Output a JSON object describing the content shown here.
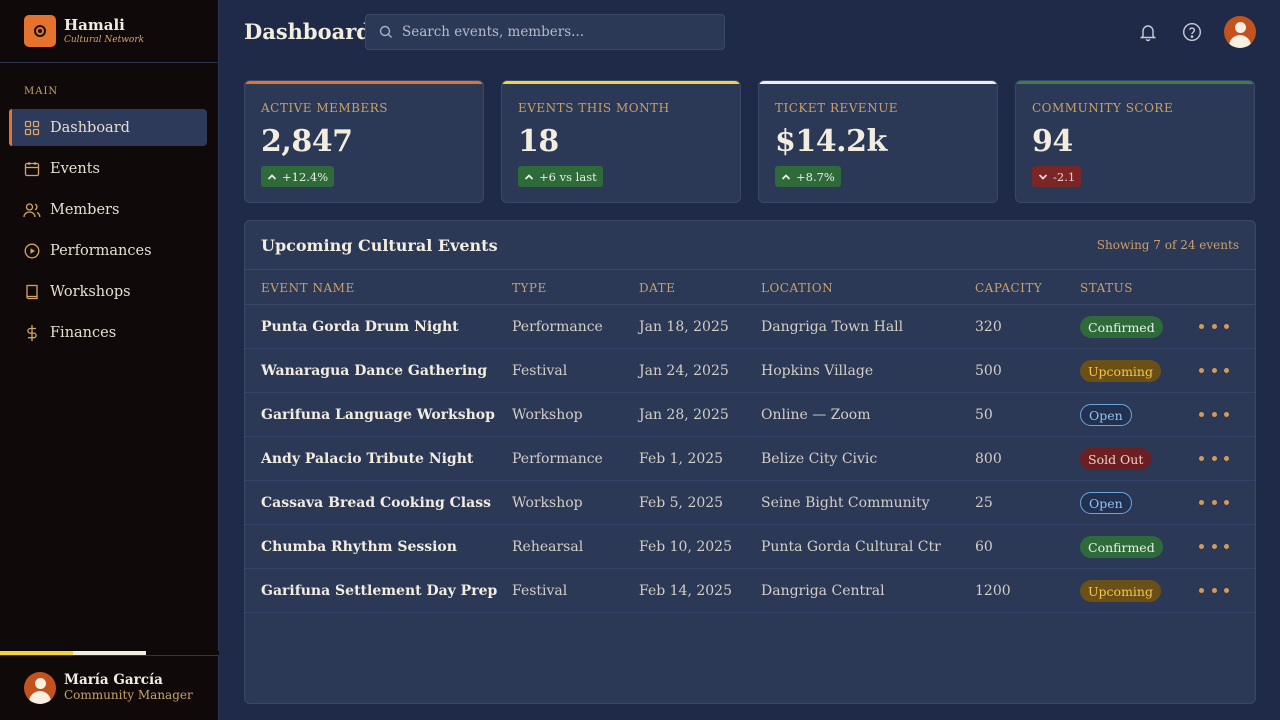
{
  "brand": {
    "name": "Hamali",
    "tagline": "Cultural Network"
  },
  "sidebar": {
    "section_label": "MAIN",
    "items": [
      {
        "label": "Dashboard",
        "icon": "grid-icon",
        "active": true
      },
      {
        "label": "Events",
        "icon": "calendar-icon",
        "active": false
      },
      {
        "label": "Members",
        "icon": "users-icon",
        "active": false
      },
      {
        "label": "Performances",
        "icon": "play-circle-icon",
        "active": false
      },
      {
        "label": "Workshops",
        "icon": "book-icon",
        "active": false
      },
      {
        "label": "Finances",
        "icon": "dollar-icon",
        "active": false
      }
    ],
    "flag_colors": [
      "#f5d33a",
      "#f3ede0",
      "#0f0a09"
    ]
  },
  "user": {
    "name": "María García",
    "role": "Community Manager"
  },
  "header": {
    "title": "Dashboard",
    "search_placeholder": "Search events, members..."
  },
  "stats": [
    {
      "label": "Active Members",
      "value": "2,847",
      "delta": "+12.4%",
      "direction": "up",
      "accent": "#e5722d"
    },
    {
      "label": "Events This Month",
      "value": "18",
      "delta": "+6 vs last",
      "direction": "up",
      "accent": "#f5d33a"
    },
    {
      "label": "Ticket Revenue",
      "value": "$14.2k",
      "delta": "+8.7%",
      "direction": "up",
      "accent": "#f3ede0"
    },
    {
      "label": "Community Score",
      "value": "94",
      "delta": "-2.1",
      "direction": "down",
      "accent": "#3f7e45"
    }
  ],
  "events_table": {
    "title": "Upcoming Cultural Events",
    "meta": "Showing 7 of 24 events",
    "columns": [
      "Event Name",
      "Type",
      "Date",
      "Location",
      "Capacity",
      "Status"
    ],
    "rows": [
      {
        "name": "Punta Gorda Drum Night",
        "type": "Performance",
        "date": "Jan 18, 2025",
        "location": "Dangriga Town Hall",
        "capacity": "320",
        "status": "Confirmed",
        "status_kind": "confirmed"
      },
      {
        "name": "Wanaragua Dance Gathering",
        "type": "Festival",
        "date": "Jan 24, 2025",
        "location": "Hopkins Village",
        "capacity": "500",
        "status": "Upcoming",
        "status_kind": "upcoming"
      },
      {
        "name": "Garifuna Language Workshop",
        "type": "Workshop",
        "date": "Jan 28, 2025",
        "location": "Online — Zoom",
        "capacity": "50",
        "status": "Open",
        "status_kind": "open"
      },
      {
        "name": "Andy Palacio Tribute Night",
        "type": "Performance",
        "date": "Feb 1, 2025",
        "location": "Belize City Civic",
        "capacity": "800",
        "status": "Sold Out",
        "status_kind": "soldout"
      },
      {
        "name": "Cassava Bread Cooking Class",
        "type": "Workshop",
        "date": "Feb 5, 2025",
        "location": "Seine Bight Community",
        "capacity": "25",
        "status": "Open",
        "status_kind": "open"
      },
      {
        "name": "Chumba Rhythm Session",
        "type": "Rehearsal",
        "date": "Feb 10, 2025",
        "location": "Punta Gorda Cultural Ctr",
        "capacity": "60",
        "status": "Confirmed",
        "status_kind": "confirmed"
      },
      {
        "name": "Garifuna Settlement Day Prep",
        "type": "Festival",
        "date": "Feb 14, 2025",
        "location": "Dangriga Central",
        "capacity": "1200",
        "status": "Upcoming",
        "status_kind": "upcoming"
      }
    ]
  }
}
